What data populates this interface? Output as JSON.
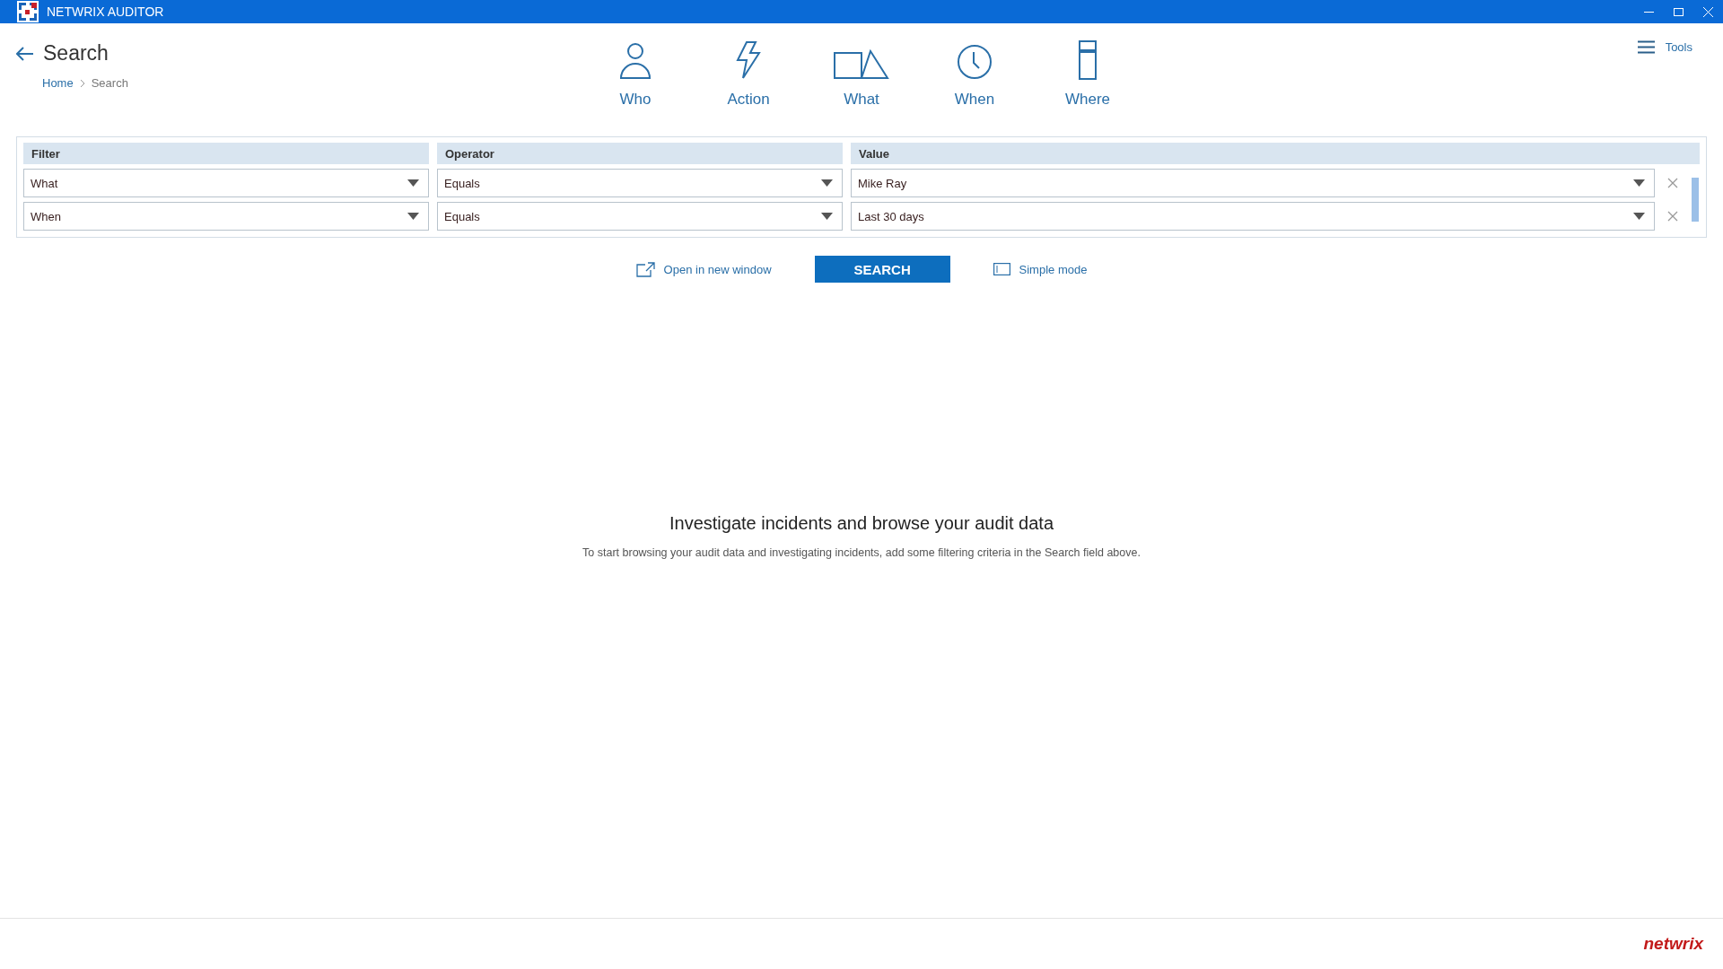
{
  "window": {
    "title": "NETWRIX AUDITOR"
  },
  "header": {
    "title": "Search",
    "breadcrumb": [
      "Home",
      "Search"
    ],
    "tools": "Tools"
  },
  "categories": [
    {
      "kind": "who",
      "label": "Who"
    },
    {
      "kind": "action",
      "label": "Action"
    },
    {
      "kind": "what",
      "label": "What"
    },
    {
      "kind": "when",
      "label": "When"
    },
    {
      "kind": "where",
      "label": "Where"
    }
  ],
  "filters": {
    "columns": [
      "Filter",
      "Operator",
      "Value"
    ],
    "rows": [
      {
        "filter": "What",
        "operator": "Equals",
        "value": "Mike Ray"
      },
      {
        "filter": "When",
        "operator": "Equals",
        "value": "Last 30 days"
      }
    ]
  },
  "actions": {
    "open_link": "Open in new window",
    "search_button": "SEARCH",
    "simple_mode": "Simple mode"
  },
  "empty_state": {
    "heading": "Investigate incidents and browse your audit data",
    "text": "To start browsing your audit data and investigating incidents, add some filtering criteria in the Search field above."
  },
  "footer": {
    "logo": "netwrix"
  }
}
